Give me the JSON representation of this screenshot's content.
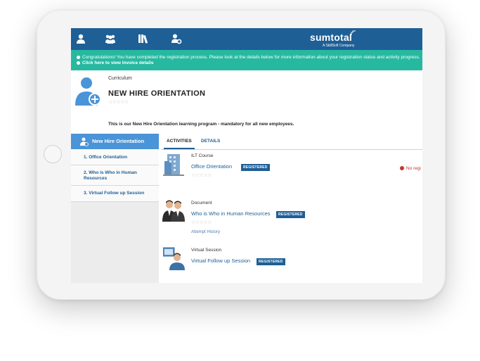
{
  "brand": {
    "name": "sumtotal",
    "tagline": "A SkillSoft Company"
  },
  "nav": [
    {
      "icon": "user-icon"
    },
    {
      "icon": "users-icon"
    },
    {
      "icon": "books-icon"
    },
    {
      "icon": "user-settings-icon"
    }
  ],
  "notice": {
    "line1": "Congratulations! You have completed the registration process. Please look at the details below for more information about your registration status and activity progress.",
    "line2": "Click here to view invoice details"
  },
  "curriculum": {
    "label": "Curriculum",
    "title": "NEW HIRE ORIENTATION",
    "description": "This is our New Hire Orientation learning program - mandatory for all new employees."
  },
  "sidebar": {
    "title": "New Hire Orientation",
    "items": [
      {
        "label": "1. Office Orientation"
      },
      {
        "label": "2. Who is Who in Human Resources"
      },
      {
        "label": "3. Virtual Follow up Session"
      }
    ]
  },
  "tabs": [
    {
      "label": "ACTIVITIES"
    },
    {
      "label": "DETAILS"
    }
  ],
  "activities": [
    {
      "type": "ILT Course",
      "title": "Office Orientation",
      "status": "REGISTERED",
      "note": "No regi"
    },
    {
      "type": "Document",
      "title": "Who is Who in Human Resources",
      "status": "REGISTERED",
      "link": "Attempt History"
    },
    {
      "type": "Virtual Session",
      "title": "Virtual Follow up Session",
      "status": "REGISTERED"
    }
  ],
  "colors": {
    "header": "#1e5f96",
    "notice": "#27b9a0",
    "sidebar_header": "#4a94d8",
    "error": "#c0392b"
  }
}
